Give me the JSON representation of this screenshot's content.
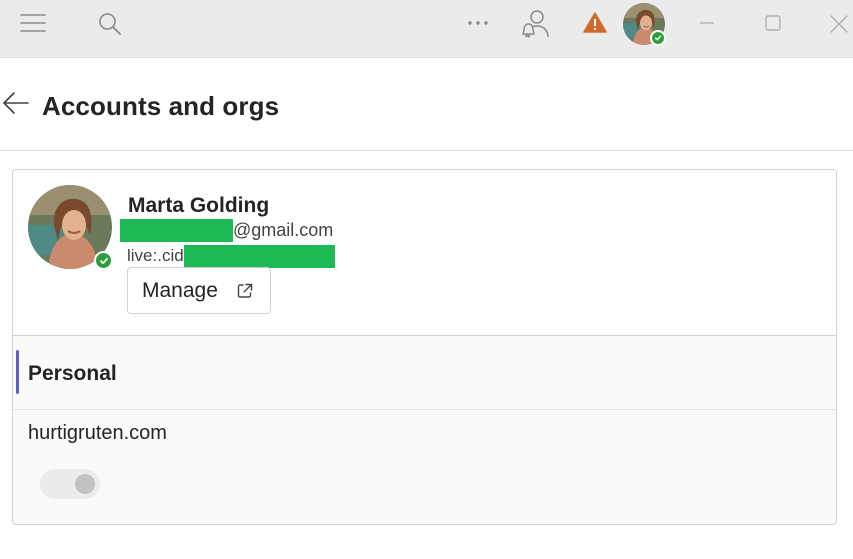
{
  "titlebar": {
    "icons": [
      "hamburger-menu-icon",
      "search-icon",
      "more-options-icon",
      "people-notification-icon",
      "warning-icon",
      "minimize-icon",
      "maximize-icon",
      "close-icon"
    ],
    "warning_color": "#d06b2e",
    "status_color": "#2e9e3a"
  },
  "header": {
    "title": "Accounts and orgs"
  },
  "profile": {
    "name": "Marta Golding",
    "email_suffix": "@gmail.com",
    "cid_prefix": "live:.cid",
    "manage_label": "Manage",
    "redaction_color": "#1db954"
  },
  "orgs": {
    "section_label": "Personal",
    "accent_color": "#5b5fc7",
    "items": [
      {
        "name": "hurtigruten.com",
        "toggle_on": false
      }
    ]
  }
}
